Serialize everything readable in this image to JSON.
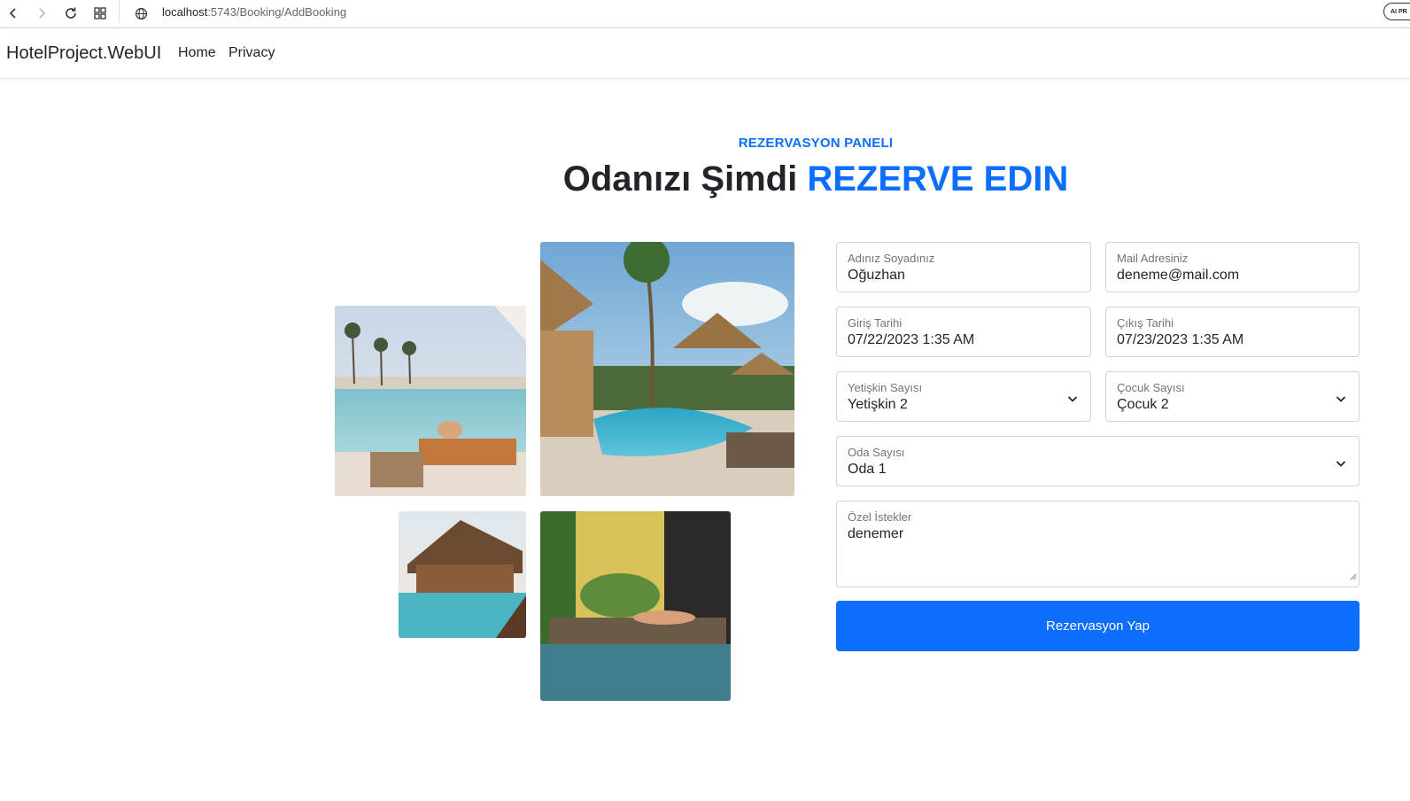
{
  "browser": {
    "url_host": "localhost",
    "url_path": ":5743/Booking/AddBooking",
    "badge": "AI PR"
  },
  "navbar": {
    "brand": "HotelProject.WebUI",
    "links": [
      "Home",
      "Privacy"
    ]
  },
  "header": {
    "subtitle": "REZERVASYON PANELI",
    "title_main": "Odanızı Şimdi",
    "title_accent": "REZERVE EDIN"
  },
  "form": {
    "name": {
      "label": "Adınız Soyadınız",
      "value": "Oğuzhan"
    },
    "email": {
      "label": "Mail Adresiniz",
      "value": "deneme@mail.com"
    },
    "checkin": {
      "label": "Giriş Tarihi",
      "value": "07/22/2023 1:35 AM"
    },
    "checkout": {
      "label": "Çıkış Tarihi",
      "value": "07/23/2023 1:35 AM"
    },
    "adults": {
      "label": "Yetişkin Sayısı",
      "value": "Yetişkin 2"
    },
    "children": {
      "label": "Çocuk Sayısı",
      "value": "Çocuk 2"
    },
    "rooms": {
      "label": "Oda Sayısı",
      "value": "Oda 1"
    },
    "requests": {
      "label": "Özel İstekler",
      "value": "denemer"
    },
    "submit_label": "Rezervasyon Yap"
  },
  "colors": {
    "accent": "#0d6efd",
    "text": "#212529",
    "muted": "#6c757d"
  }
}
